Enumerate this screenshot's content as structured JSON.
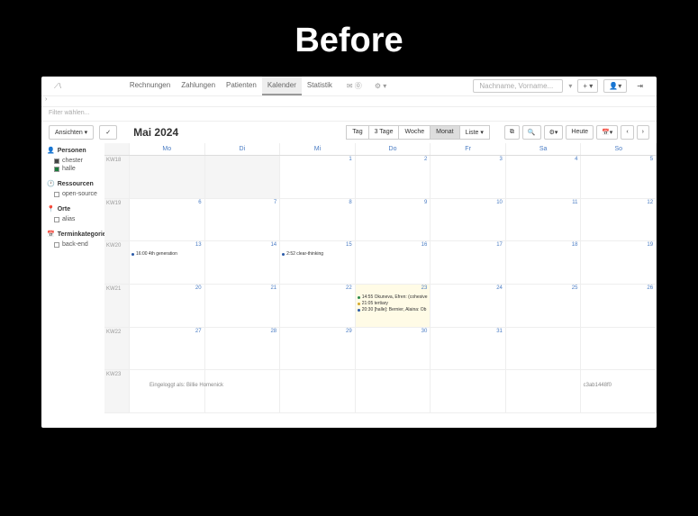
{
  "overlay_title": "Before",
  "nav": {
    "items": [
      "Rechnungen",
      "Zahlungen",
      "Patienten",
      "Kalender",
      "Statistik"
    ],
    "active": 3
  },
  "search_placeholder": "Nachname, Vorname...",
  "filter_placeholder": "Filter wählen...",
  "ansichten_label": "Ansichten ▾",
  "month_title": "Mai 2024",
  "views": {
    "items": [
      "Tag",
      "3 Tage",
      "Woche",
      "Monat",
      "Liste ▾"
    ],
    "active": 3
  },
  "heute_label": "Heute",
  "sidebar": {
    "personen": {
      "title": "Personen",
      "items": [
        {
          "label": "chester",
          "color": "dark"
        },
        {
          "label": "halle",
          "color": "green"
        }
      ]
    },
    "ressourcen": {
      "title": "Ressourcen",
      "items": [
        "open-source"
      ]
    },
    "orte": {
      "title": "Orte",
      "items": [
        "alias"
      ]
    },
    "terminkategorien": {
      "title": "Terminkategorien",
      "items": [
        "back-end"
      ]
    }
  },
  "dow": [
    "Mo",
    "Di",
    "Mi",
    "Do",
    "Fr",
    "Sa",
    "So"
  ],
  "weeks": [
    {
      "kw": "KW18",
      "days": [
        "",
        "",
        "1",
        "2",
        "3",
        "4",
        "5"
      ],
      "grey": [
        0,
        1
      ]
    },
    {
      "kw": "KW19",
      "days": [
        "6",
        "7",
        "8",
        "9",
        "10",
        "11",
        "12"
      ]
    },
    {
      "kw": "KW20",
      "days": [
        "13",
        "14",
        "15",
        "16",
        "17",
        "18",
        "19"
      ],
      "events": {
        "0": [
          {
            "t": "16:00",
            "txt": "4th generation"
          }
        ],
        "2": [
          {
            "t": "2:52",
            "txt": "clear-thinking"
          }
        ]
      }
    },
    {
      "kw": "KW21",
      "days": [
        "20",
        "21",
        "22",
        "23",
        "24",
        "25",
        "26"
      ],
      "hl": 3,
      "events": {
        "3": [
          {
            "t": "14:55",
            "txt": "Okuneva, Efren: (cohesive",
            "c": "g"
          },
          {
            "t": "21:05",
            "txt": "tertiary",
            "c": "y"
          },
          {
            "t": "20:30",
            "txt": "[halle]: Bernier, Alaina: Ob"
          }
        ]
      }
    },
    {
      "kw": "KW22",
      "days": [
        "27",
        "28",
        "29",
        "30",
        "31",
        "",
        ""
      ]
    },
    {
      "kw": "KW23",
      "days": [
        "",
        "",
        "",
        "",
        "",
        "",
        ""
      ]
    }
  ],
  "footer": {
    "login": "Eingeloggt als: Billie Homenick",
    "build": "c3ab1448f0"
  }
}
